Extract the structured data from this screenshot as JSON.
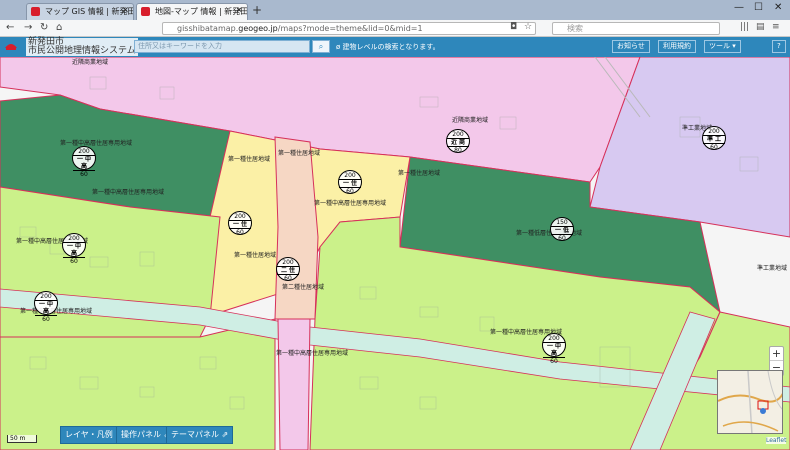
{
  "browser": {
    "tabs": [
      {
        "title": "マップ GIS 情報 | 新発田市市",
        "active": false
      },
      {
        "title": "地図-マップ 情報 | 新発田市市",
        "active": true
      }
    ],
    "url_prefix": "gisshibatamap.",
    "url_domain": "geogeo.jp",
    "url_path": "/maps?mode=theme&lid=0&mid=1",
    "search_placeholder": "検索"
  },
  "header": {
    "logo_line1": "新発田市",
    "logo_line2": "市民公開地理情報システム",
    "keyword_placeholder": "住所又はキーワードを入力",
    "search_button": "⌕",
    "hint": "ø 建物レベルの検索となります。",
    "buttons": [
      "お知らせ",
      "利用規約",
      "ツール ▾",
      "?"
    ],
    "expand": "▾"
  },
  "map": {
    "zones": [
      {
        "name": "第一種中高層住居専用地域",
        "far": "200",
        "type": "一 中 高",
        "bcr": "60"
      },
      {
        "name": "第一種住居地域",
        "far": "200",
        "type": "一 住",
        "bcr": "60"
      },
      {
        "name": "第二種住居地域",
        "far": "200",
        "type": "二 住",
        "bcr": "60"
      },
      {
        "name": "近隣商業地域",
        "far": "200",
        "type": "近 商",
        "bcr": "80"
      },
      {
        "name": "準工業地域",
        "far": "200",
        "type": "準 工",
        "bcr": "60"
      },
      {
        "name": "第一種低層住居専用地域",
        "far": "150",
        "type": "一 低",
        "bcr": "60"
      }
    ],
    "labels": [
      "近隣商業地域",
      "第一種中高層住居専用地域",
      "第一種住居地域",
      "第一種住居地域",
      "第一種中高層住居専用地域",
      "第一種住居地域",
      "近隣商業地域",
      "準工業地域",
      "第一種中高層住居専用地域",
      "第一種住居地域",
      "第一種低層住居専用地域",
      "第二種住居地域",
      "第一種中高層住居専用地域",
      "第一種中高層住居専用地域",
      "第一種中高層住居専用地域",
      "第一種中高層住居専用地域",
      "準工業地域"
    ],
    "scale_text": "50 m",
    "zoom_in": "+",
    "zoom_out": "−",
    "attribution": "Leaflet"
  },
  "panels": [
    "レイヤ・凡例 ⇗",
    "操作パネル ⇗",
    "テーマパネル ⇗"
  ],
  "colors": {
    "header": "#2e87bb",
    "commercial": "#f3c8ea",
    "industrial": "#d7c9f1",
    "mid_high": "#3f8f63",
    "residential1": "#fbf0a6",
    "residential2": "#f6d7c4",
    "low_rise": "#cbf18a",
    "road_corridor": "#cfeee4"
  }
}
